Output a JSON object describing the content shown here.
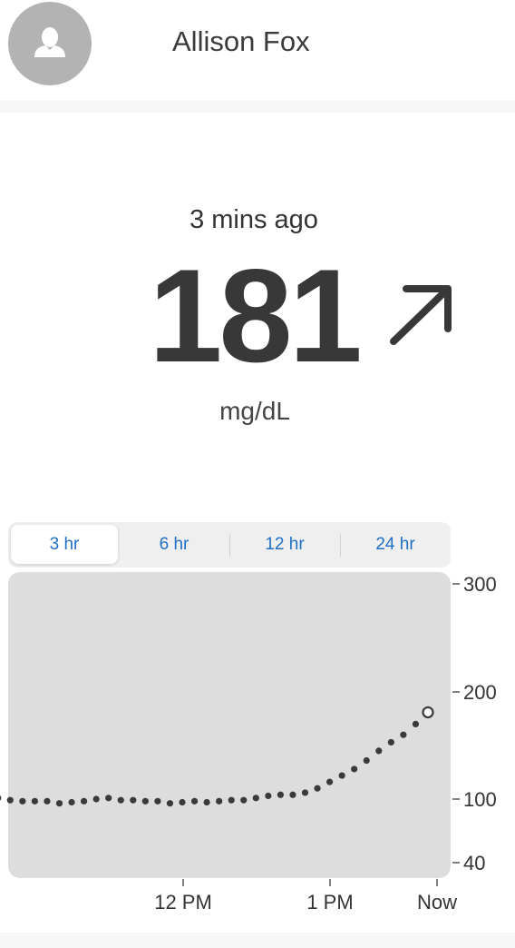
{
  "header": {
    "user_name": "Allison Fox",
    "avatar_icon": "person-icon"
  },
  "reading": {
    "time_ago": "3 mins ago",
    "value": "181",
    "unit": "mg/dL",
    "trend_icon": "arrow-up-right-icon"
  },
  "ranges": {
    "options": [
      "3 hr",
      "6 hr",
      "12 hr",
      "24 hr"
    ],
    "selected": "3 hr"
  },
  "chart_data": {
    "type": "scatter",
    "y_ticks": [
      300,
      200,
      100,
      40
    ],
    "ylim": [
      40,
      300
    ],
    "x_ticks": [
      "12 PM",
      "1 PM",
      "Now"
    ],
    "grid": false,
    "interval_minutes": 5,
    "points_before_now": 38,
    "values": [
      117,
      112,
      108,
      104,
      101,
      99,
      98,
      98,
      98,
      96,
      97,
      98,
      100,
      101,
      99,
      99,
      98,
      98,
      96,
      97,
      98,
      97,
      98,
      99,
      99,
      101,
      103,
      104,
      104,
      106,
      110,
      116,
      122,
      128,
      136,
      145,
      153,
      160,
      170,
      181
    ],
    "latest_value": 181,
    "colors": {
      "background": "#dddddd",
      "point": "#3a3a3a"
    }
  }
}
